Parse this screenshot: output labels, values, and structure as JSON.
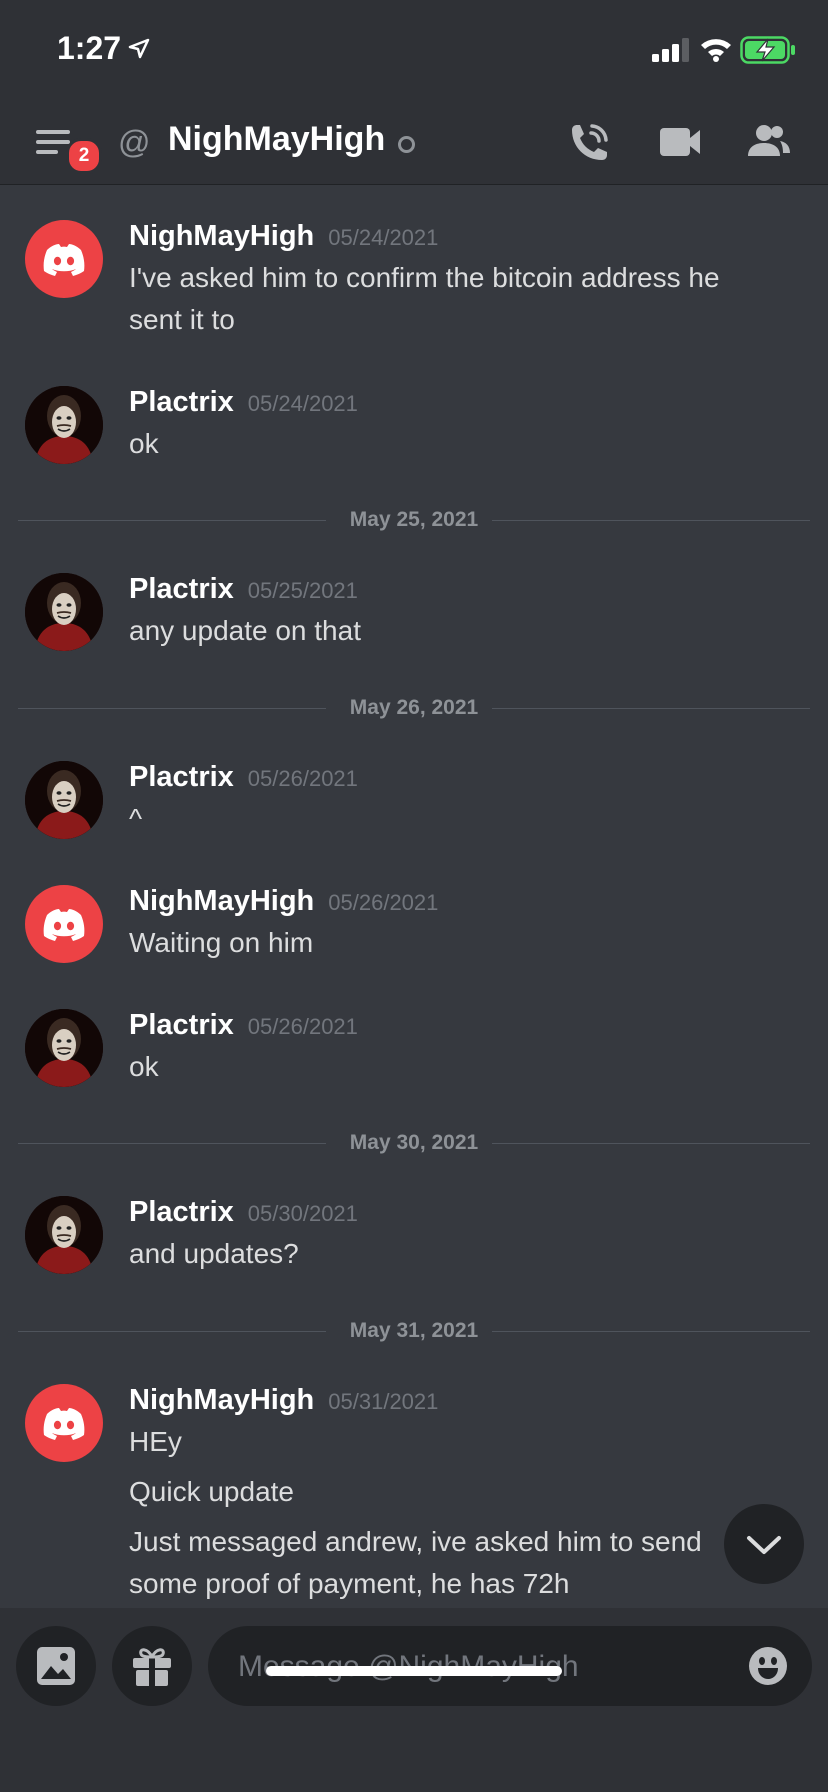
{
  "status_bar": {
    "time": "1:27"
  },
  "header": {
    "title": "NighMayHigh",
    "unread_count": "2"
  },
  "messages": [
    {
      "author": "NighMayHigh",
      "avatar": "discord-logo-icon",
      "timestamp": "05/24/2021",
      "lines": [
        "I've asked him to confirm the bitcoin address he",
        "sent it to"
      ]
    },
    {
      "author": "Plactrix",
      "avatar": "masked-figure-avatar",
      "timestamp": "05/24/2021",
      "lines": [
        "ok"
      ]
    },
    {
      "divider": "May 25, 2021"
    },
    {
      "author": "Plactrix",
      "avatar": "masked-figure-avatar",
      "timestamp": "05/25/2021",
      "lines": [
        "any update on that"
      ]
    },
    {
      "divider": "May 26, 2021"
    },
    {
      "author": "Plactrix",
      "avatar": "masked-figure-avatar",
      "timestamp": "05/26/2021",
      "lines": [
        "^"
      ]
    },
    {
      "author": "NighMayHigh",
      "avatar": "discord-logo-icon",
      "timestamp": "05/26/2021",
      "lines": [
        "Waiting on him"
      ]
    },
    {
      "author": "Plactrix",
      "avatar": "masked-figure-avatar",
      "timestamp": "05/26/2021",
      "lines": [
        "ok"
      ]
    },
    {
      "divider": "May 30, 2021"
    },
    {
      "author": "Plactrix",
      "avatar": "masked-figure-avatar",
      "timestamp": "05/30/2021",
      "lines": [
        "and updates?"
      ]
    },
    {
      "divider": "May 31, 2021"
    },
    {
      "author": "NighMayHigh",
      "avatar": "discord-logo-icon",
      "timestamp": "05/31/2021",
      "lines": [
        "HEy",
        "Quick update",
        "Just messaged andrew, ive asked him to send",
        "some proof of payment, he has 72h"
      ]
    }
  ],
  "composer": {
    "placeholder": "Message @NighMayHigh"
  },
  "colors": {
    "background": "#36393f",
    "header": "#2f3136",
    "discord_red": "#ed4245",
    "battery_green": "#4cd964"
  }
}
